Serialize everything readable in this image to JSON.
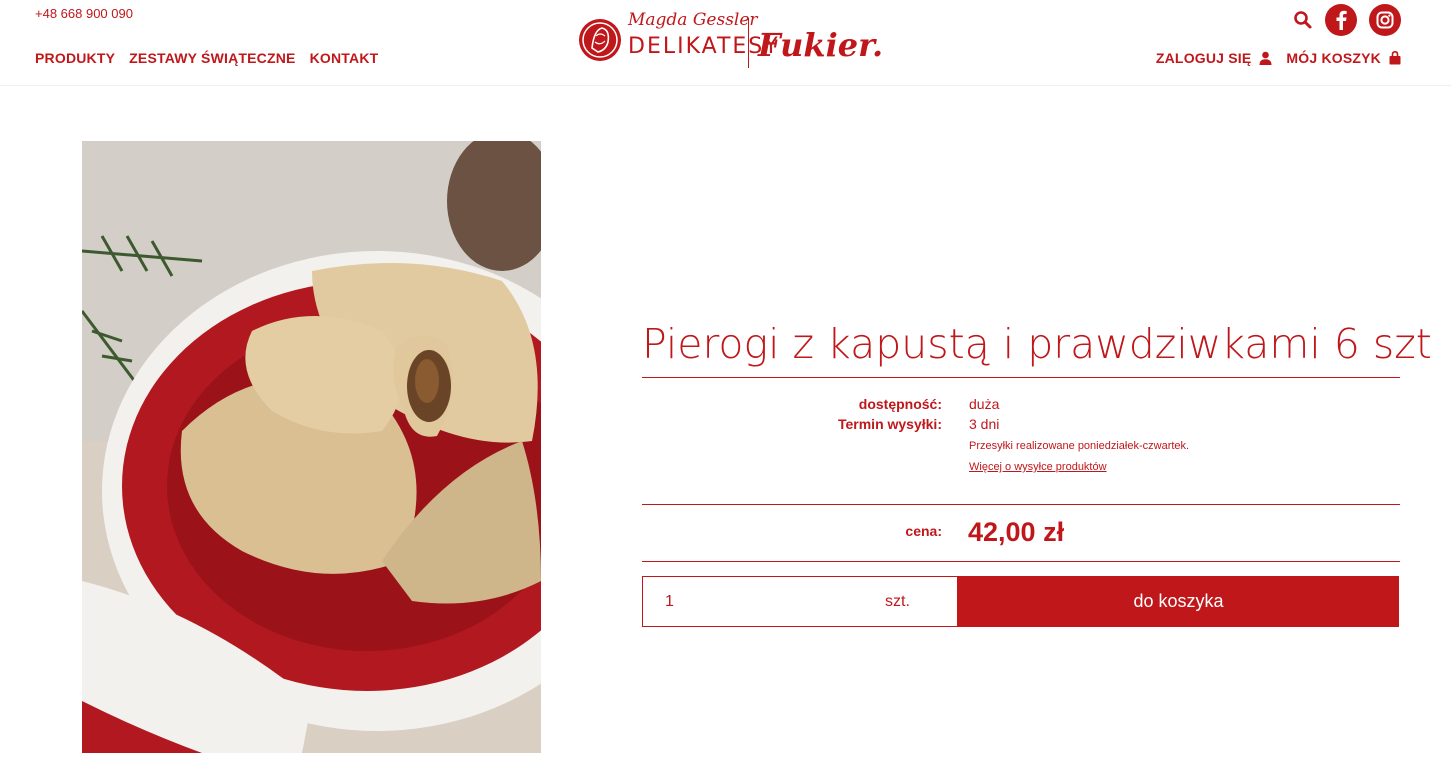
{
  "header": {
    "phone": "+48 668 900 090",
    "nav": [
      "PRODUKTY",
      "ZESTAWY ŚWIĄTECZNE",
      "KONTAKT"
    ],
    "login_label": "ZALOGUJ SIĘ",
    "cart_label": "MÓJ KOSZYK",
    "logo": {
      "line1": "Magda Gessler",
      "line2": "DELIKATESY",
      "line3": "Fukier."
    }
  },
  "product": {
    "title": "Pierogi z kapustą i prawdziwkami 6 szt",
    "availability_label": "dostępność:",
    "availability_value": "duża",
    "shipping_label": "Termin wysyłki:",
    "shipping_value": "3 dni",
    "shipping_note": "Przesyłki realizowane poniedziałek-czwartek.",
    "shipping_link": "Więcej o wysyłce produktów",
    "price_label": "cena:",
    "price": "42,00 zł",
    "quantity": "1",
    "unit": "szt.",
    "add_to_cart": "do koszyka"
  },
  "colors": {
    "brand": "#c0171b",
    "background": "#ffffff"
  },
  "icons": [
    "search-icon",
    "facebook-icon",
    "instagram-icon",
    "user-icon",
    "bag-icon"
  ]
}
